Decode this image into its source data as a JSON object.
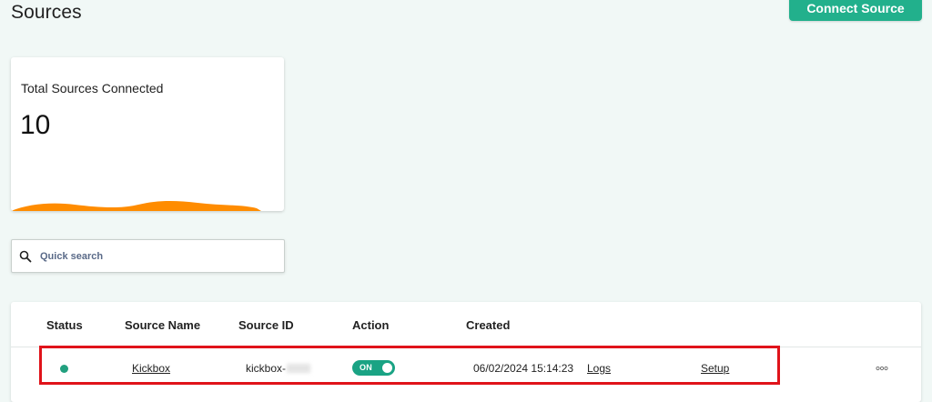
{
  "header": {
    "title": "Sources",
    "connect_button_label": "Connect Source"
  },
  "stat_card": {
    "label": "Total Sources Connected",
    "value": "10",
    "wave_color": "#ff8c00"
  },
  "search": {
    "placeholder": "Quick search",
    "value": "",
    "icon": "search-icon"
  },
  "table": {
    "columns": [
      "Status",
      "Source Name",
      "Source ID",
      "Action",
      "Created"
    ],
    "rows": [
      {
        "status": "active",
        "status_color": "#22a07f",
        "source_name": "Kickbox",
        "source_id": "kickbox-",
        "action_toggle": "ON",
        "created": "06/02/2024 15:14:23",
        "logs_label": "Logs",
        "setup_label": "Setup",
        "more_icon": "more-horizontal-icon"
      }
    ]
  },
  "colors": {
    "accent": "#22b08c",
    "highlight": "#e0131a",
    "background": "#f1f8f6"
  }
}
